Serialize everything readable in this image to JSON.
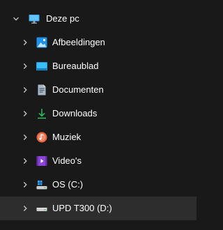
{
  "tree": {
    "root": {
      "label": "Deze pc",
      "icon": "monitor-icon",
      "expanded": true
    },
    "items": [
      {
        "label": "Afbeeldingen",
        "icon": "pictures-icon",
        "color": "#1e90e8"
      },
      {
        "label": "Bureaublad",
        "icon": "desktop-icon",
        "color": "#2aa6e6"
      },
      {
        "label": "Documenten",
        "icon": "documents-icon",
        "color": "#9aa8ba"
      },
      {
        "label": "Downloads",
        "icon": "download-icon",
        "color": "#2fbf62"
      },
      {
        "label": "Muziek",
        "icon": "music-icon",
        "color": "#e8603c"
      },
      {
        "label": "Video's",
        "icon": "video-icon",
        "color": "#8b44d6"
      },
      {
        "label": "OS (C:)",
        "icon": "windows-drive-icon",
        "color": "#cfcfcf"
      },
      {
        "label": "UPD T300 (D:)",
        "icon": "drive-icon",
        "color": "#cfcfcf",
        "selected": true
      }
    ]
  },
  "colors": {
    "background": "#191919",
    "selected_row": "#2d2d2d",
    "text": "#ffffff",
    "chevron": "#c8c8c8"
  }
}
